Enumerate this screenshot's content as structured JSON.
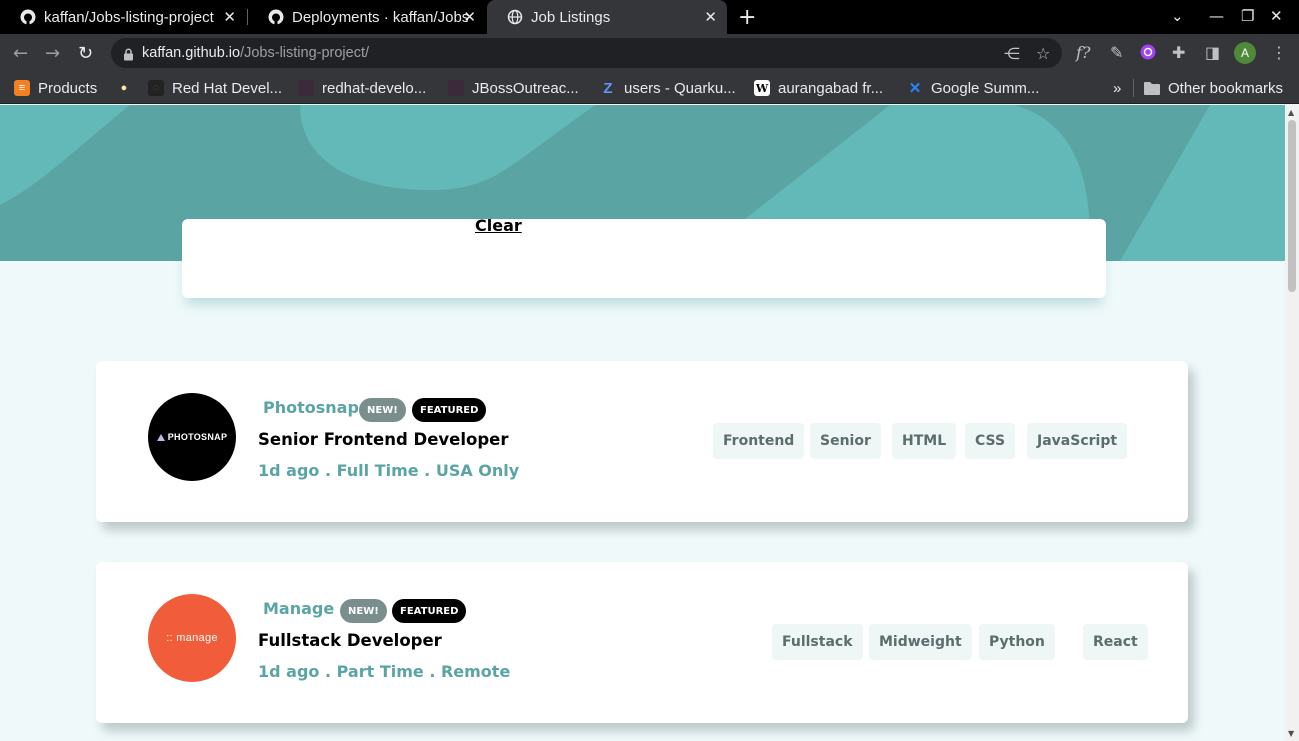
{
  "browser": {
    "tabs": [
      {
        "title": "kaffan/Jobs-listing-project",
        "icon": "github-icon",
        "active": false
      },
      {
        "title": "Deployments · kaffan/Jobs-listing-project",
        "icon": "github-icon",
        "active": false
      },
      {
        "title": "Job Listings",
        "icon": "globe-icon",
        "active": true
      }
    ],
    "url_host": "kaffan.github.io",
    "url_path": "/Jobs-listing-project/",
    "avatar_letter": "A",
    "bookmarks": [
      {
        "label": "Products",
        "icon": "stack-icon"
      },
      {
        "label": "",
        "icon": "bulb-icon"
      },
      {
        "label": "Red Hat Devel...",
        "icon": "github-icon"
      },
      {
        "label": "redhat-develo...",
        "icon": "bookmark-icon"
      },
      {
        "label": "JBossOutreac...",
        "icon": "bookmark-icon"
      },
      {
        "label": "users - Quarku...",
        "icon": "zulip-icon"
      },
      {
        "label": "aurangabad fr...",
        "icon": "wikipedia-icon"
      },
      {
        "label": "Google Summ...",
        "icon": "confluence-icon"
      }
    ],
    "other_bookmarks": "Other bookmarks"
  },
  "page": {
    "filter": {
      "clear_label": "Clear"
    },
    "jobs": [
      {
        "company": "Photosnap",
        "logo_text": "PHOTOSNAP",
        "logo_color": "#000000",
        "new_label": "NEW!",
        "featured_label": "FEATURED",
        "position": "Senior Frontend Developer",
        "meta": "1d ago . Full Time . USA Only",
        "tags": [
          "Frontend",
          "Senior",
          "HTML",
          "CSS",
          "JavaScript"
        ]
      },
      {
        "company": "Manage",
        "logo_text": ":: manage",
        "logo_color": "#f15c3a",
        "new_label": "NEW!",
        "featured_label": "FEATURED",
        "position": "Fullstack Developer",
        "meta": "1d ago . Part Time . Remote",
        "tags": [
          "Fullstack",
          "Midweight",
          "Python",
          "React"
        ]
      }
    ]
  },
  "colors": {
    "primary": "#5ba4a4",
    "background": "#eff9fa",
    "tag_bg": "#eff6f6",
    "tag_text": "#5b6d6d"
  }
}
